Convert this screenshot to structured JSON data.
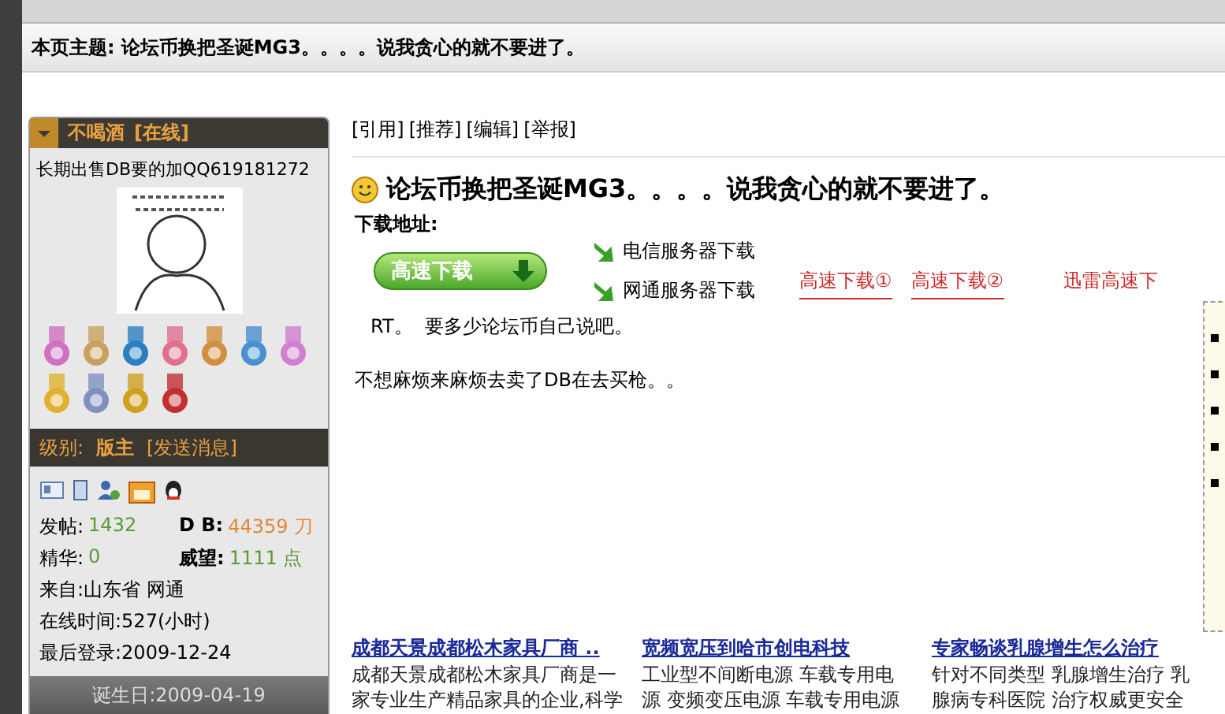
{
  "topic_bar": {
    "label": "本页主题:",
    "title": "论坛币换把圣诞MG3。。。。说我贪心的就不要进了。"
  },
  "profile": {
    "name": "不喝酒",
    "status": "[在线]",
    "signature": "长期出售DB要的加QQ619181272",
    "level_label": "级别:",
    "level": "版主",
    "message_link": "[发送消息]",
    "stats": [
      {
        "label": "发帖:",
        "value": "1432",
        "color": "#5a9a3a"
      },
      {
        "label": "D B:",
        "value": "44359 刀",
        "color": "#e0883a"
      },
      {
        "label": "精华:",
        "value": "0",
        "color": "#5a9a3a"
      },
      {
        "label": "威望:",
        "value": "1111 点",
        "color": "#5a9a3a"
      }
    ],
    "info": [
      "来自:山东省 网通",
      "在线时间:527(小时)",
      "最后登录:2009-12-24"
    ],
    "footer": "诞生日:2009-04-19"
  },
  "post": {
    "actions": [
      "[引用]",
      "[推荐]",
      "[编辑]",
      "[举报]"
    ],
    "title": "论坛币换把圣诞MG3。。。。说我贪心的就不要进了。",
    "download_label": "下载地址:",
    "download_button": "高速下载",
    "servers": [
      "电信服务器下载",
      "网通服务器下载"
    ],
    "links": [
      "高速下载①",
      "高速下载②",
      "迅雷高速下"
    ],
    "body": [
      "RT。  要多少论坛币自己说吧。",
      "不想麻烦来麻烦去卖了DB在去买枪。。"
    ]
  },
  "ads": [
    {
      "title": "成都天景成都松木家具厂商 ..",
      "lines": [
        "成都天景成都松木家具厂商是一",
        "家专业生产精品家具的企业,科学"
      ]
    },
    {
      "title": "宽频宽压到哈市创电科技",
      "lines": [
        "工业型不间断电源 车载专用电",
        "源 变频变压电源 车载专用电源"
      ]
    },
    {
      "title": "专家畅谈乳腺增生怎么治疗",
      "lines": [
        "针对不同类型 乳腺增生治疗 乳",
        "腺病专科医院 治疗权威更安全"
      ]
    }
  ]
}
